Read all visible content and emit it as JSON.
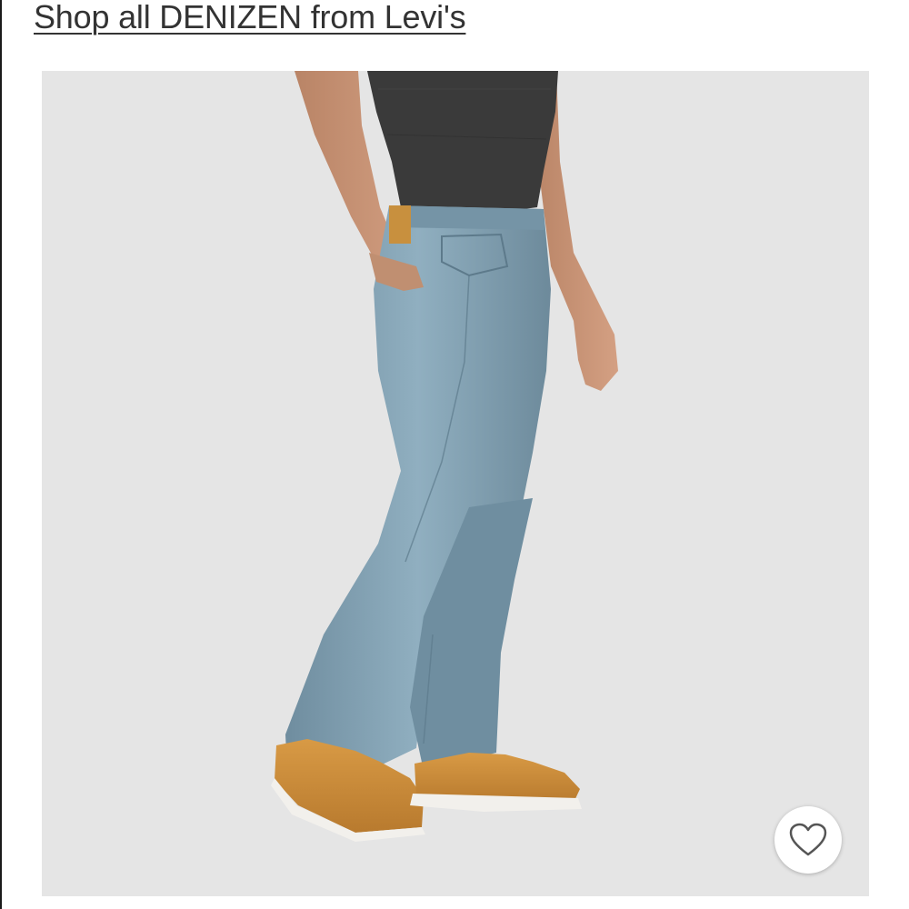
{
  "header": {
    "shop_link_label": "Shop all DENIZEN from Levi's"
  },
  "product": {
    "image_subject": "jeans-on-model",
    "favorite_icon": "heart-outline-icon"
  },
  "colors": {
    "image_background": "#e5e5e5",
    "link_text": "#333333",
    "denim": "#7f9fb0",
    "shirt": "#3a3a3a",
    "shoe": "#c98d3a"
  }
}
